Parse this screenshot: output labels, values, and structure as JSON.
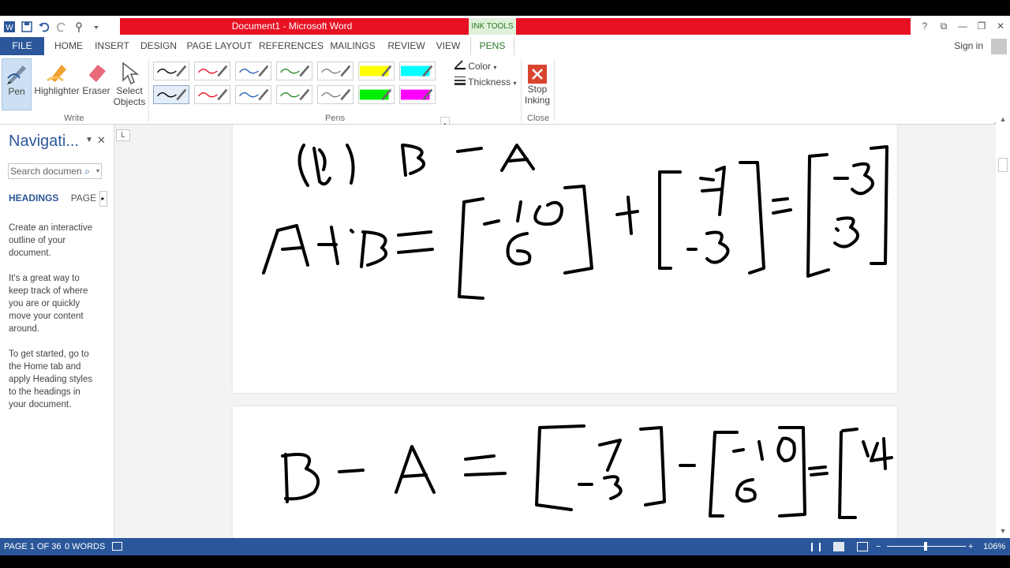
{
  "window": {
    "title": "Document1 - Microsoft Word",
    "context_group": "INK TOOLS",
    "buttons": [
      "?",
      "⧉",
      "—",
      "❐",
      "✕"
    ]
  },
  "quick_access": [
    "word-logo",
    "save-icon",
    "undo-icon",
    "redo-icon",
    "touch-mode-icon",
    "customize-icon"
  ],
  "tabs": [
    "FILE",
    "HOME",
    "INSERT",
    "DESIGN",
    "PAGE LAYOUT",
    "REFERENCES",
    "MAILINGS",
    "REVIEW",
    "VIEW",
    "PENS"
  ],
  "account": {
    "sign_in": "Sign in"
  },
  "ribbon": {
    "write": {
      "label": "Write",
      "pen": "Pen",
      "highlighter": "Highlighter",
      "eraser": "Eraser",
      "select": "Select",
      "objects": "Objects"
    },
    "pens": {
      "label": "Pens",
      "row1_colors": [
        "#000000",
        "#e81123",
        "#2b64b0",
        "#2a8a2a",
        "#808080",
        "#ffff00",
        "#00ffff"
      ],
      "row2_colors": [
        "#000000",
        "#e81123",
        "#2b64b0",
        "#2a8a2a",
        "#808080",
        "#00ee00",
        "#ff00ff"
      ],
      "color": "Color",
      "thickness": "Thickness"
    },
    "close": {
      "label": "Close",
      "stop": "Stop",
      "inking": "Inking"
    }
  },
  "nav": {
    "title": "Navigati...",
    "search_placeholder": "Search documen",
    "tab_headings": "HEADINGS",
    "tab_pages": "PAGE",
    "help1": "Create an interactive outline of your document.",
    "help2": "It's a great way to keep track of where you are or quickly move your content around.",
    "help3": "To get started, go to the Home tab and apply Heading styles to the headings in your document."
  },
  "ruler_label": "L",
  "status": {
    "page": "PAGE 1 OF 36",
    "words": "0 WORDS",
    "zoom": "106%",
    "zoom_minus": "−",
    "zoom_plus": "+"
  }
}
